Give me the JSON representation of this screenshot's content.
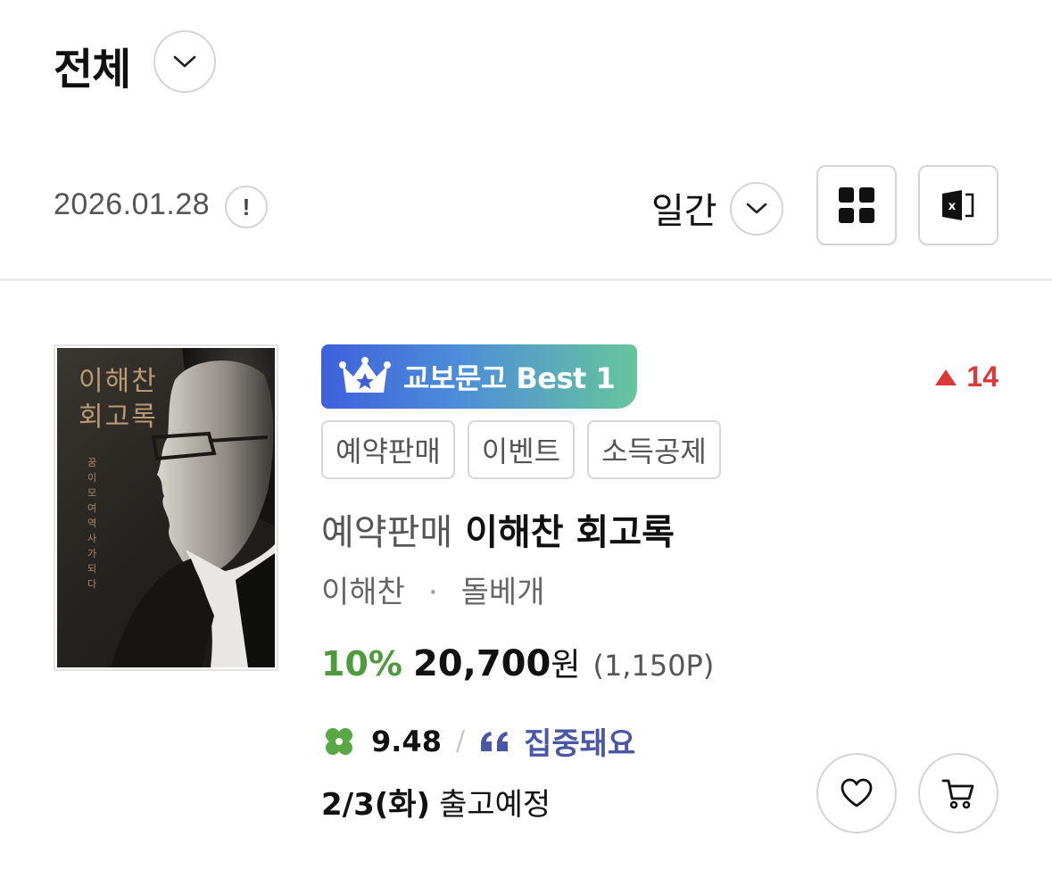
{
  "header": {
    "category_title": "전체",
    "date": "2026.01.28",
    "info_symbol": "!",
    "period_label": "일간"
  },
  "product": {
    "cover": {
      "title_line1": "이해찬",
      "title_line2": "회고록",
      "subtitle": "꿈이모여역사가되다"
    },
    "rank_badge": "교보문고 Best 1",
    "rank_change": "14",
    "tags": [
      "예약판매",
      "이벤트",
      "소득공제"
    ],
    "title_prefix": "예약판매",
    "title": "이해찬 회고록",
    "author": "이해찬",
    "publisher": "돌베개",
    "discount": "10%",
    "price": "20,700",
    "currency": "원",
    "points": "(1,150P)",
    "rating": "9.48",
    "review_keyword": "집중돼요",
    "ship_date": "2/3(화)",
    "ship_label": "출고예정"
  },
  "colors": {
    "discount_green": "#4f9a3c",
    "rank_up_red": "#d9393b",
    "review_blue": "#4a56a8",
    "clover_green": "#5aa844",
    "badge_gradient_start": "#3f60dc",
    "badge_gradient_end": "#66c69b"
  },
  "icons": {
    "category_toggle": "chevron-down-icon",
    "info": "info-icon",
    "period_toggle": "chevron-down-icon",
    "grid_view": "grid-icon",
    "excel_download": "excel-icon",
    "crown": "crown-icon",
    "rank_up": "triangle-up-icon",
    "clover": "clover-icon",
    "quote": "quote-icon",
    "wishlist": "heart-icon",
    "cart": "cart-icon"
  }
}
